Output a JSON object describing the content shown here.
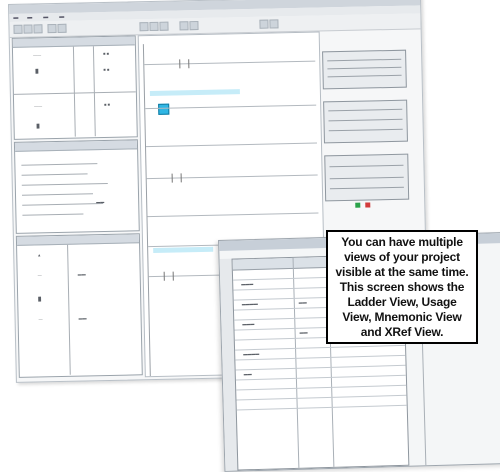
{
  "callout": {
    "text": "You can have multiple views of your project visible at the same time. This screen shows the  Ladder View, Usage View, Mnemonic View and XRef View."
  },
  "views": [
    "Ladder View",
    "Usage View",
    "Mnemonic View",
    "XRef View"
  ],
  "colors": {
    "highlight": "#2fb6e4",
    "callout_border": "#000000",
    "window_frame": "#9ea6ae"
  }
}
